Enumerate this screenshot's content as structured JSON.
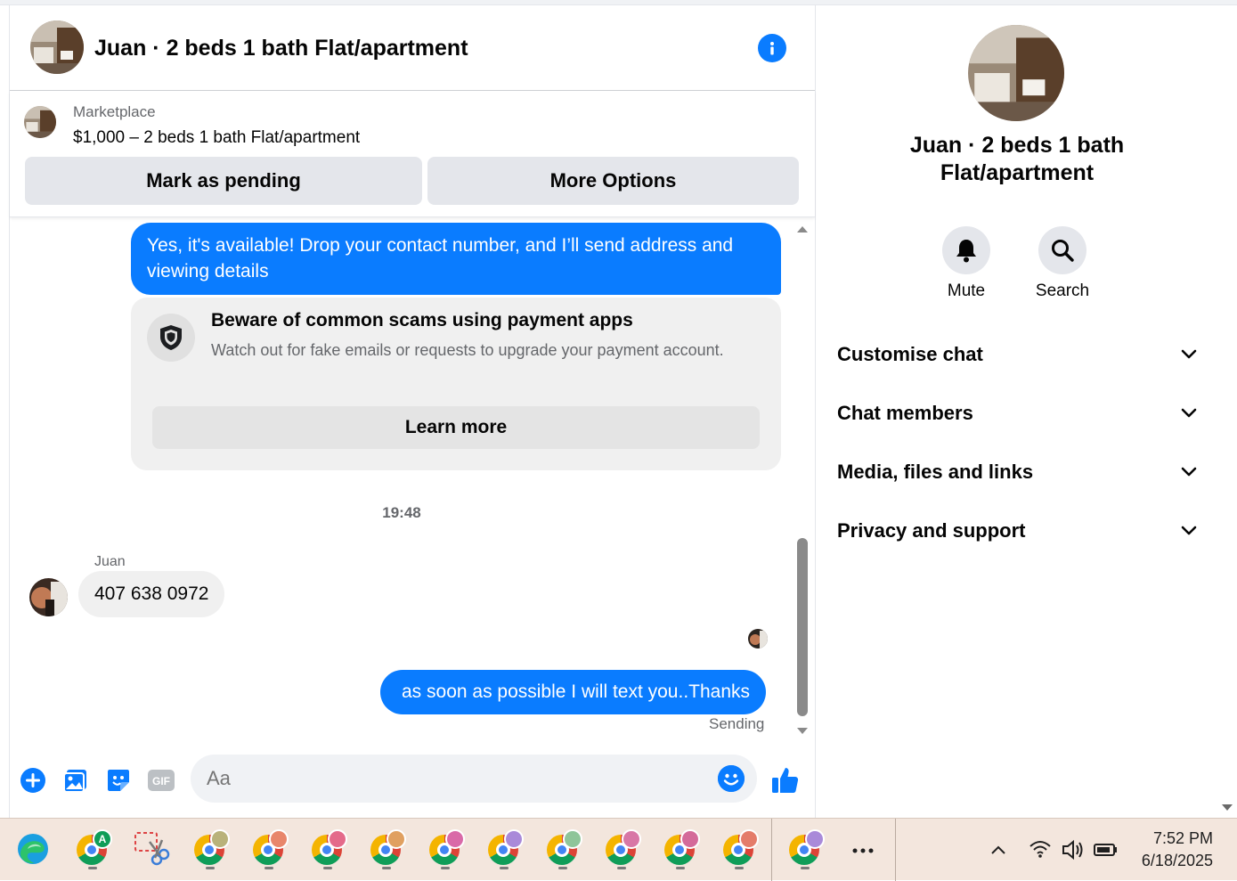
{
  "header": {
    "title": "Juan · 2 beds 1 bath Flat/apartment"
  },
  "listing": {
    "source": "Marketplace",
    "summary": "$1,000 – 2 beds 1 bath Flat/apartment",
    "mark_pending_label": "Mark as pending",
    "more_options_label": "More Options"
  },
  "messages": {
    "outgoing_1": "Yes, it's available! Drop your contact number, and I’ll send address and viewing details",
    "scam_notice": {
      "title": "Beware of common scams using payment apps",
      "body": "Watch out for fake emails or requests to upgrade your payment account.",
      "button": "Learn more"
    },
    "timestamp": "19:48",
    "incoming_sender": "Juan",
    "incoming_1": "407 638 0972",
    "outgoing_2": "as soon as possible I will text you..Thanks",
    "status": "Sending"
  },
  "composer": {
    "placeholder": "Aa",
    "gif_label": "GIF"
  },
  "right_panel": {
    "title": "Juan · 2 beds 1 bath Flat/apartment",
    "mute_label": "Mute",
    "search_label": "Search",
    "sections": [
      "Customise chat",
      "Chat members",
      "Media, files and links",
      "Privacy and support"
    ]
  },
  "taskbar": {
    "time": "7:52 PM",
    "date": "6/18/2025",
    "chrome_profile_colors": [
      "#0f9d58",
      "#b9b27a",
      "#e8866b",
      "#e46a8a",
      "#e0a060",
      "#d96aa8",
      "#a98ad9",
      "#8fc59a",
      "#d877a6",
      "#d46a9a",
      "#e47c6a",
      "#a98ad9"
    ],
    "profile_letter": "A"
  },
  "colors": {
    "messenger_blue": "#0a7cff",
    "bubble_gray": "#f0f0f0",
    "secondary_text": "#65676b"
  }
}
